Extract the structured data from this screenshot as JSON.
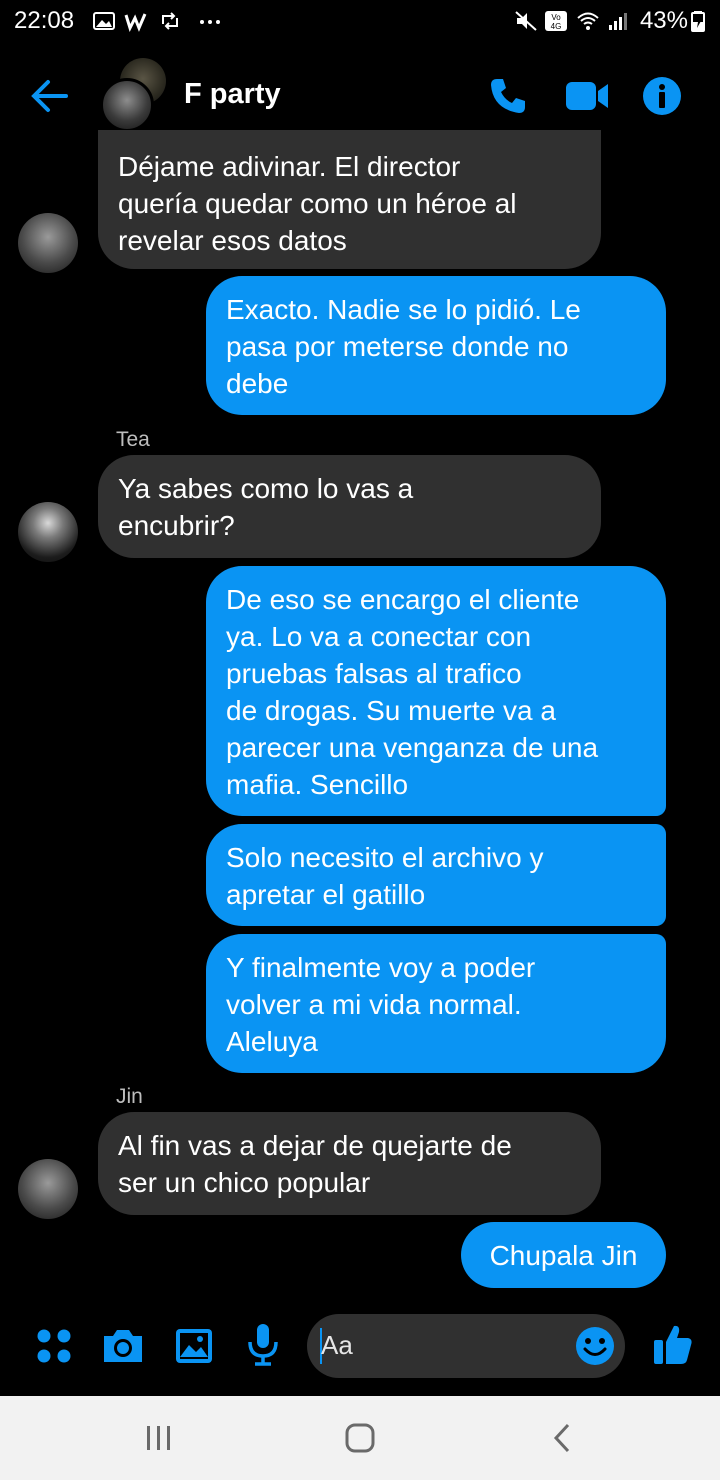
{
  "status_bar": {
    "time": "22:08",
    "battery_percent": "43%",
    "icons": [
      "gallery-icon",
      "w-app-icon",
      "retweet-icon",
      "more-icon",
      "mute-icon",
      "volte-icon",
      "wifi-icon",
      "signal-icon",
      "battery-icon"
    ],
    "volte_label": "Vo\n4G"
  },
  "header": {
    "title": "F party",
    "back_icon": "back-arrow-icon",
    "actions": [
      "phone-icon",
      "video-camera-icon",
      "info-icon"
    ],
    "accent": "#0a94f3"
  },
  "messages": [
    {
      "direction": "in",
      "sender": "",
      "lines": [
        "Déjame adivinar. El director",
        "quería quedar como un héroe al",
        "revelar esos datos"
      ]
    },
    {
      "direction": "out",
      "lines": [
        "Exacto. Nadie se lo pidió. Le",
        "pasa por meterse donde no",
        "debe"
      ]
    },
    {
      "direction": "in",
      "sender": "Tea",
      "lines": [
        "Ya sabes como lo vas a",
        "encubrir?"
      ]
    },
    {
      "direction": "out",
      "lines": [
        "De eso se encargo el cliente",
        "ya. Lo va a conectar con",
        "pruebas falsas al trafico",
        "de drogas. Su muerte va a",
        "parecer una venganza de una",
        "mafia. Sencillo"
      ]
    },
    {
      "direction": "out",
      "lines": [
        "Solo necesito el archivo y",
        "apretar el gatillo"
      ]
    },
    {
      "direction": "out",
      "lines": [
        "Y finalmente voy a poder",
        "volver a mi vida normal.",
        "Aleluya"
      ]
    },
    {
      "direction": "in",
      "sender": "Jin",
      "lines": [
        "Al fin vas a dejar de quejarte de",
        "ser un chico popular"
      ]
    },
    {
      "direction": "out",
      "lines": [
        "Chupala Jin"
      ]
    }
  ],
  "composer": {
    "placeholder": "Aa",
    "icons": [
      "apps-icon",
      "camera-icon",
      "gallery-icon",
      "microphone-icon",
      "emoji-icon",
      "thumbs-up-icon"
    ]
  },
  "navbar": {
    "icons": [
      "recent-apps-icon",
      "home-icon",
      "back-icon"
    ]
  },
  "colors": {
    "background": "#000000",
    "incoming_bubble": "#303030",
    "outgoing_bubble": "#0a94f3",
    "accent": "#0a94f3"
  }
}
